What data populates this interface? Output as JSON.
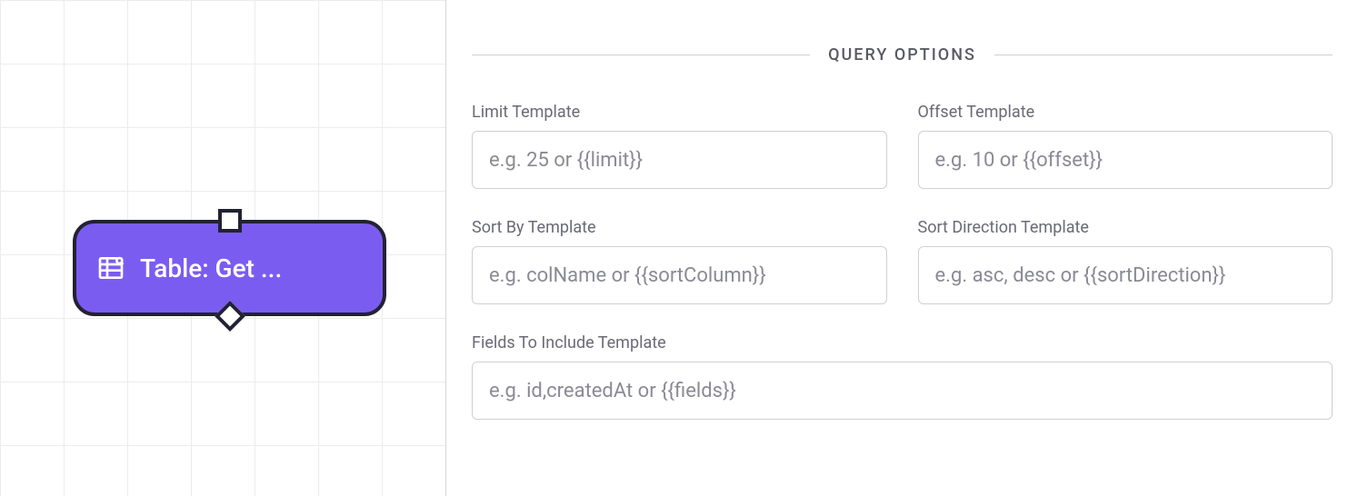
{
  "canvas": {
    "node_label": "Table: Get ..."
  },
  "panel": {
    "section_title": "QUERY OPTIONS",
    "fields": {
      "limit": {
        "label": "Limit Template",
        "placeholder": "e.g. 25 or {{limit}}",
        "value": ""
      },
      "offset": {
        "label": "Offset Template",
        "placeholder": "e.g. 10 or {{offset}}",
        "value": ""
      },
      "sort_by": {
        "label": "Sort By Template",
        "placeholder": "e.g. colName or {{sortColumn}}",
        "value": ""
      },
      "sort_dir": {
        "label": "Sort Direction Template",
        "placeholder": "e.g. asc, desc or {{sortDirection}}",
        "value": ""
      },
      "fields": {
        "label": "Fields To Include Template",
        "placeholder": "e.g. id,createdAt or {{fields}}",
        "value": ""
      }
    }
  }
}
